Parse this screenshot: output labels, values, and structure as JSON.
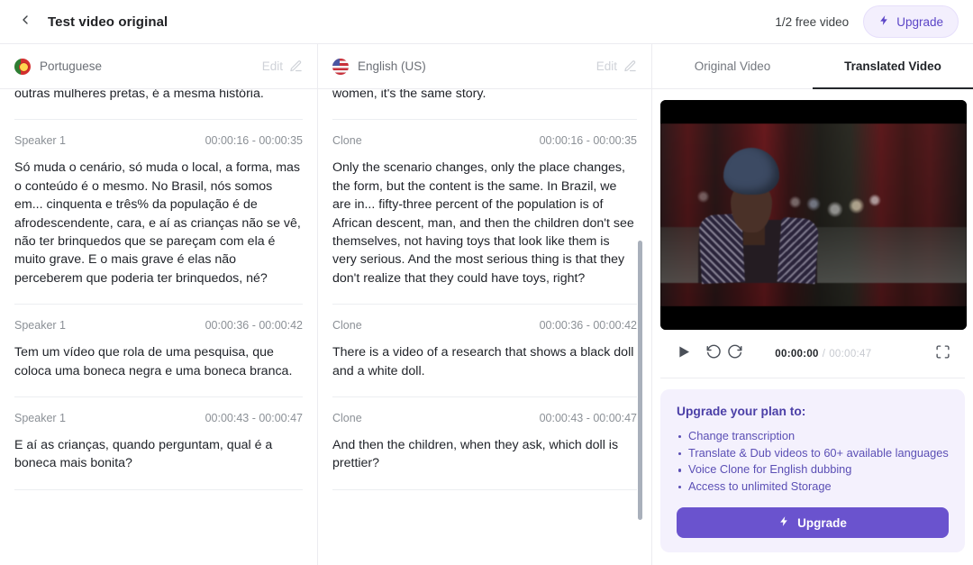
{
  "header": {
    "back_icon": "chevron-left-icon",
    "title": "Test video original",
    "free_video_text": "1/2 free video",
    "upgrade_label": "Upgrade",
    "upgrade_icon": "lightning-bolt-icon"
  },
  "columns": [
    {
      "flag": "portugal-flag-icon",
      "language": "Portuguese",
      "edit_label": "Edit",
      "edit_icon": "pencil-square-icon",
      "segments": [
        {
          "speaker": "",
          "time": "",
          "text": "outras mulheres pretas, é a mesma história."
        },
        {
          "speaker": "Speaker 1",
          "time": "00:00:16 - 00:00:35",
          "text": "Só muda o cenário, só muda o local, a forma, mas o conteúdo é o mesmo. No Brasil, nós somos em... cinquenta e três% da população é de afrodescendente, cara, e aí as crianças não se vê, não ter brinquedos que se pareçam com ela é muito grave. E o mais grave é elas não perceberem que poderia ter brinquedos, né?"
        },
        {
          "speaker": "Speaker 1",
          "time": "00:00:36 - 00:00:42",
          "text": "Tem um vídeo que rola de uma pesquisa, que coloca uma boneca negra e uma boneca branca."
        },
        {
          "speaker": "Speaker 1",
          "time": "00:00:43 - 00:00:47",
          "text": "E aí as crianças, quando perguntam, qual é a boneca mais bonita?"
        }
      ]
    },
    {
      "flag": "usa-flag-icon",
      "language": "English (US)",
      "edit_label": "Edit",
      "edit_icon": "pencil-square-icon",
      "segments": [
        {
          "speaker": "",
          "time": "",
          "text": "women, it's the same story."
        },
        {
          "speaker": "Clone",
          "time": "00:00:16 - 00:00:35",
          "text": "Only the scenario changes, only the place changes, the form, but the content is the same. In Brazil, we are in... fifty-three percent of the population is of African descent, man, and then the children don't see themselves, not having toys that look like them is very serious. And the most serious thing is that they don't realize that they could have toys, right?"
        },
        {
          "speaker": "Clone",
          "time": "00:00:36 - 00:00:42",
          "text": "There is a video of a research that shows a black doll and a white doll."
        },
        {
          "speaker": "Clone",
          "time": "00:00:43 - 00:00:47",
          "text": "And then the children, when they ask, which doll is prettier?"
        }
      ]
    }
  ],
  "right_panel": {
    "tabs": [
      {
        "label": "Original Video",
        "active": false
      },
      {
        "label": "Translated Video",
        "active": true
      }
    ],
    "player": {
      "play_icon": "play-icon",
      "rewind_icon": "rewind-10-icon",
      "forward_icon": "forward-10-icon",
      "fullscreen_icon": "fullscreen-icon",
      "current_time": "00:00:00",
      "separator": "/",
      "duration": "00:00:47"
    },
    "upgrade_card": {
      "title": "Upgrade your plan to:",
      "benefits": [
        "Change transcription",
        "Translate & Dub videos to 60+ available languages",
        "Voice Clone for English dubbing",
        "Access to unlimited Storage"
      ],
      "cta_label": "Upgrade",
      "cta_icon": "lightning-bolt-icon"
    }
  },
  "colors": {
    "accent_purple": "#6a53ce",
    "accent_purple_light": "#f4f1fd",
    "accent_text": "#5b4fb5",
    "border": "#ececf0",
    "text_primary": "#21242a",
    "text_muted": "#8b9096"
  }
}
